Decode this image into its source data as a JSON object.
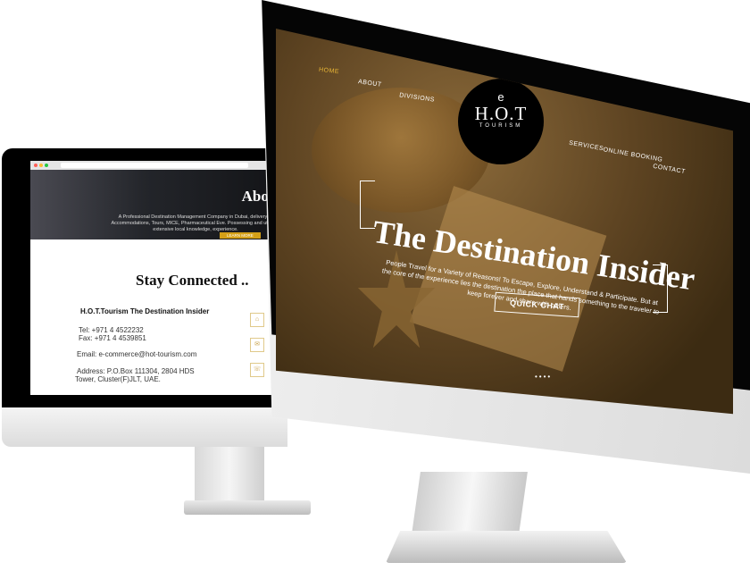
{
  "back_screen": {
    "about_title": "About",
    "about_text": "A Professional Destination Management Company in Dubai, delivery of Accommodations, Tours, MICE, Pharmaceutical Eve. Possessing and utilizing extensive local knowledge, experience.",
    "learn_more": "LEARN MORE",
    "stay_connected": "Stay Connected ..",
    "company": "H.O.T.Tourism The Destination Insider",
    "tel": "Tel: +971 4 4522232",
    "fax": "Fax: +971 4 4539851",
    "email": "Email: e-commerce@hot-tourism.com",
    "address_1": "Address: P.O.Box 111304, 2804 HDS",
    "address_2": "Tower, Cluster(F)JLT, UAE.",
    "icons": [
      "location-icon",
      "mail-icon",
      "phone-icon"
    ]
  },
  "front_screen": {
    "nav": {
      "home": "HOME",
      "about": "ABOUT",
      "divisions": "DIVISIONS",
      "services": "SERVICES",
      "online_booking": "ONLINE BOOKING",
      "contact": "CONTACT"
    },
    "logo": {
      "mark": "e",
      "name": "H.O.T",
      "sub": "TOURISM"
    },
    "headline": "The Destination Insider",
    "subline": "People Travel for a Variety of Reasons! To Escape, Explore, Understand & Participate. But at the core of the experience lies the destination the place that hands something to the traveler to keep forever and share with others.",
    "cta": "QUICK CHAT",
    "slider_dots": "••••"
  },
  "colors": {
    "accent": "#e8b636",
    "learn_button": "#d4a017",
    "frame": "#000000"
  }
}
